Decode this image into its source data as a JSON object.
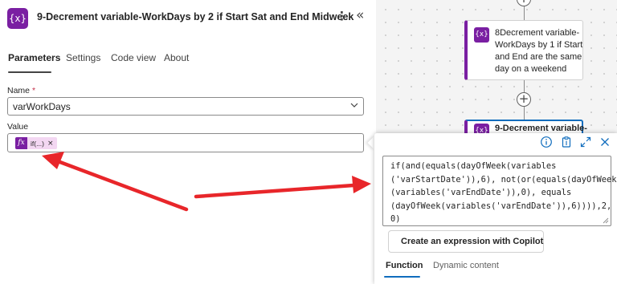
{
  "header": {
    "icon_text": "{x}",
    "title": "9-Decrement variable-WorkDays by 2 if Start Sat and End Midweek",
    "more_icon": "more-vertical-icon",
    "collapse_icon": "double-chevron-left-icon"
  },
  "tabs": [
    {
      "label": "Parameters",
      "active": true
    },
    {
      "label": "Settings",
      "active": false
    },
    {
      "label": "Code view",
      "active": false
    },
    {
      "label": "About",
      "active": false
    }
  ],
  "form": {
    "name_label": "Name",
    "required_mark": "*",
    "name_value": "varWorkDays",
    "value_label": "Value",
    "token_icon": "fx",
    "token_label": "if(...)",
    "token_close": "×"
  },
  "canvas": {
    "card1_icon": "{x}",
    "card1_title": "8Decrement variable-WorkDays by 1 if Start and End are the same day on a weekend",
    "card2_icon": "{x}",
    "card2_title": "9-Decrement variable-"
  },
  "popup": {
    "expression_lines": [
      "if(and(equals(dayOfWeek(variables",
      "('varStartDate')),6), not(or(equals(dayOfWeek",
      "(variables('varEndDate')),0), equals",
      "(dayOfWeek(variables('varEndDate')),6)))),2,",
      "0)"
    ],
    "copilot_label": "Create an expression with Copilot",
    "tabs": [
      {
        "label": "Function",
        "active": true
      },
      {
        "label": "Dynamic content",
        "active": false
      }
    ]
  },
  "colors": {
    "accent_purple": "#7a1fa2",
    "token_bg": "#f3d7f2",
    "link_blue": "#0f6cbd",
    "annotation_red": "#e8262a"
  }
}
